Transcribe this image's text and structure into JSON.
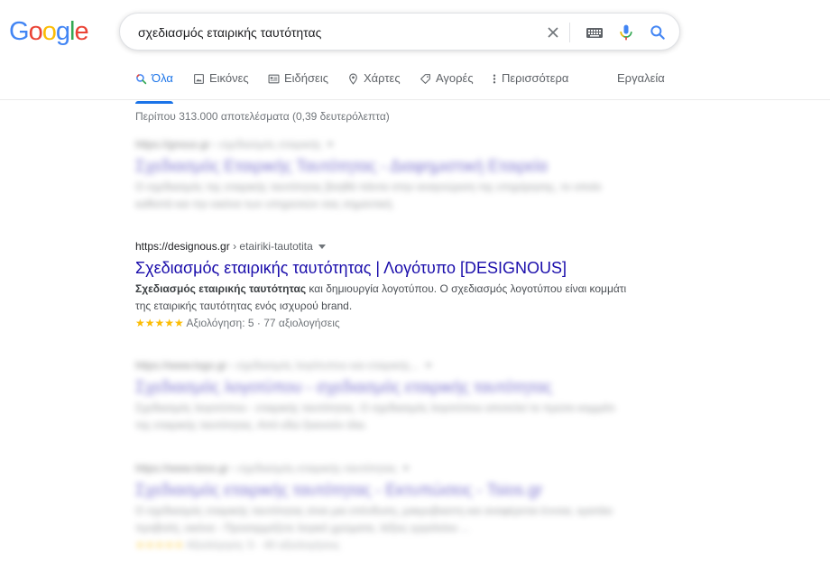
{
  "logo": {
    "letters": [
      "G",
      "o",
      "o",
      "g",
      "l",
      "e"
    ],
    "colors": [
      "#4285f4",
      "#ea4335",
      "#fbbc05",
      "#4285f4",
      "#34a853",
      "#ea4335"
    ]
  },
  "search": {
    "query": "σχεδιασμός εταιρικής ταυτότητας"
  },
  "tabs": [
    {
      "label": "Όλα",
      "icon": "search-icon",
      "active": true
    },
    {
      "label": "Εικόνες",
      "icon": "image-icon"
    },
    {
      "label": "Ειδήσεις",
      "icon": "news-icon"
    },
    {
      "label": "Χάρτες",
      "icon": "map-pin-icon"
    },
    {
      "label": "Αγορές",
      "icon": "tag-icon"
    },
    {
      "label": "Περισσότερα",
      "icon": "more-vert-icon"
    }
  ],
  "tools_label": "Εργαλεία",
  "stats": "Περίπου 313.000 αποτελέσματα (0,39 δευτερόλεπτα)",
  "results": [
    {
      "blurred": true,
      "cite_domain": "https://gnous.gr",
      "cite_path": " › σχεδιασμός εταιρικής",
      "title": "Σχεδιασμός Εταιρικής Ταυτότητας - Διαφημιστική Εταιρεία",
      "snippet": "Ο σχεδιασμός της εταιρικής ταυτότητας βοηθά πάντα στην αναγνώριση της επιχείρησης, το οποίο καθιστά και την εικόνα των υπηρεσιών σας σημαντική."
    },
    {
      "blurred": false,
      "cite_domain": "https://designous.gr",
      "cite_path": " › etairiki-tautotita",
      "title": "Σχεδιασμός εταιρικής ταυτότητας | Λογότυπο [DESIGNOUS]",
      "snippet_bold": "Σχεδιασμός εταιρικής ταυτότητας",
      "snippet_rest": " και δημιουργία λογοτύπου. Ο σχεδιασμός λογοτύπου είναι κομμάτι της εταιρικής ταυτότητας ενός ισχυρού brand.",
      "stars": "★★★★★",
      "rating_text": "Αξιολόγηση: 5 · 77 αξιολογήσεις"
    },
    {
      "blurred": true,
      "cite_domain": "https://www.logo.gr",
      "cite_path": " › σχεδιασμός λογότυπου και εταιρικής...",
      "title": "Σχεδιασμός λογοτύπου - σχεδιασμός εταιρικής ταυτότητας",
      "snippet": "Σχεδιασμός λογοτύπου - εταιρικής ταυτότητας. Ο σχεδιασμός λογοτύπου αποτελεί το πρώτο κομμάτι της εταιρικής ταυτότητας. Από εδώ ξεκινούν όλα."
    },
    {
      "blurred": true,
      "cite_domain": "https://www.tsios.gr",
      "cite_path": " › σχεδιασμός-εταιρικής-ταυτότητας",
      "title": "Σχεδιασμός εταιρικής ταυτότητας - Εκτυπώσεις - Tsios.gr",
      "snippet": "Ο σχεδιασμός εταιρικής ταυτότητας είναι μια επένδυση, μακρυβιαστη και αναφέρεται έννοια, κρατάει προβολή, εικόνα - Προσαρμόζετε λογικό χρώματα, λέξεις εργαλείου ...",
      "stars": "★★★★★",
      "rating_text": "Αξιολόγηση: 5 · 40 αξιολογήσεις"
    }
  ]
}
